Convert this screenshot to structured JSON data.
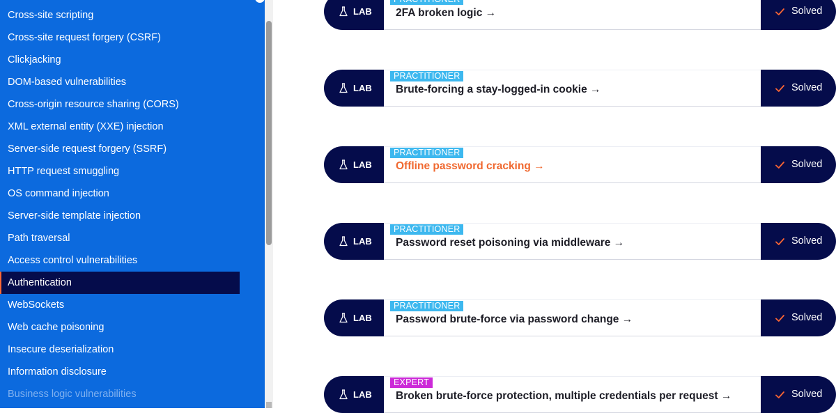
{
  "sidebar": {
    "items": [
      {
        "label": "Cross-site scripting"
      },
      {
        "label": "Cross-site request forgery (CSRF)"
      },
      {
        "label": "Clickjacking"
      },
      {
        "label": "DOM-based vulnerabilities"
      },
      {
        "label": "Cross-origin resource sharing (CORS)"
      },
      {
        "label": "XML external entity (XXE) injection"
      },
      {
        "label": "Server-side request forgery (SSRF)"
      },
      {
        "label": "HTTP request smuggling"
      },
      {
        "label": "OS command injection"
      },
      {
        "label": "Server-side template injection"
      },
      {
        "label": "Path traversal"
      },
      {
        "label": "Access control vulnerabilities"
      },
      {
        "label": "Authentication",
        "active": true
      },
      {
        "label": "WebSockets"
      },
      {
        "label": "Web cache poisoning"
      },
      {
        "label": "Insecure deserialization"
      },
      {
        "label": "Information disclosure"
      },
      {
        "label": "Business logic vulnerabilities",
        "faded": true
      }
    ]
  },
  "labs": [
    {
      "type_label": "LAB",
      "level": "PRACTITIONER",
      "title": "2FA broken logic →",
      "status": "Solved"
    },
    {
      "type_label": "LAB",
      "level": "PRACTITIONER",
      "title": "Brute-forcing a stay-logged-in cookie →",
      "status": "Solved"
    },
    {
      "type_label": "LAB",
      "level": "PRACTITIONER",
      "title": "Offline password cracking →",
      "status": "Solved",
      "highlighted": true
    },
    {
      "type_label": "LAB",
      "level": "PRACTITIONER",
      "title": "Password reset poisoning via middleware →",
      "status": "Solved"
    },
    {
      "type_label": "LAB",
      "level": "PRACTITIONER",
      "title": "Password brute-force via password change →",
      "status": "Solved"
    },
    {
      "type_label": "LAB",
      "level": "EXPERT",
      "title": "Broken brute-force protection, multiple credentials per request →",
      "status": "Solved"
    }
  ],
  "icons": {
    "lab": "flask-icon",
    "solved": "check-icon"
  },
  "colors": {
    "sidebar_bg": "#0c6ade",
    "navy": "#050c4b",
    "practitioner_badge": "#3db8ef",
    "expert_badge": "#cc2ad8",
    "highlight_title": "#f0682f",
    "check": "#ff6633"
  }
}
